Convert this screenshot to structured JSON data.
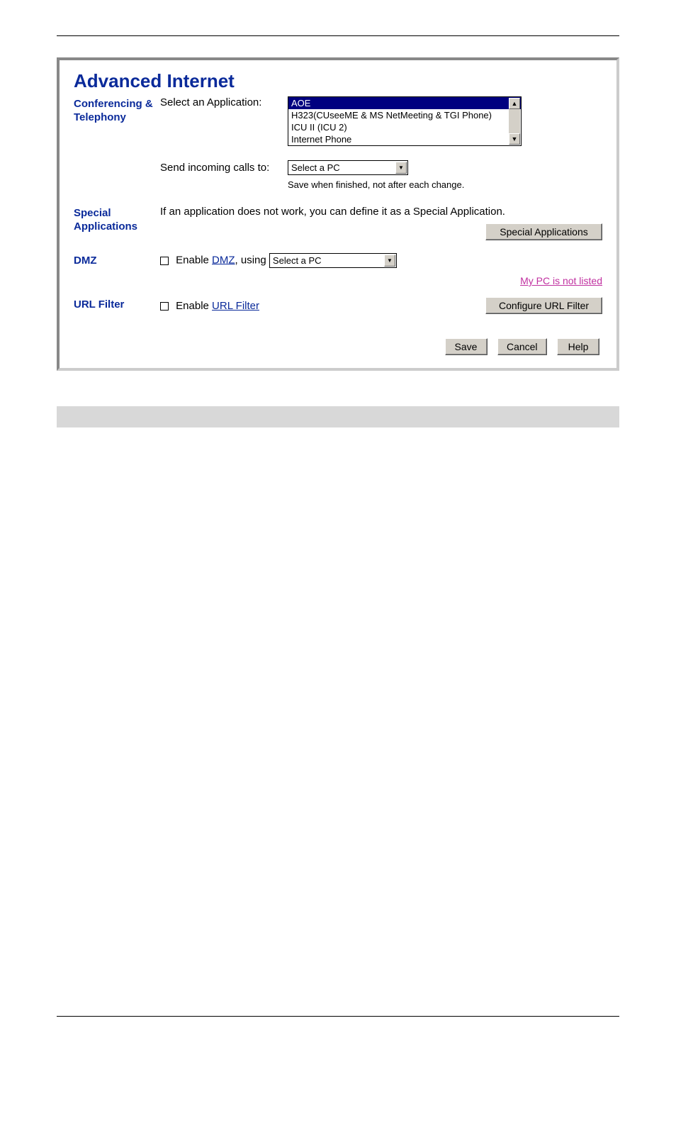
{
  "panel": {
    "title": "Advanced Internet",
    "sections": {
      "conferencing": {
        "label": "Conferencing & Telephony",
        "select_app_label": "Select an Application:",
        "app_options": [
          "AOE",
          "H323(CUseeME & MS NetMeeting & TGI Phone)",
          "ICU II (ICU 2)",
          "Internet Phone"
        ],
        "send_calls_label": "Send incoming calls to:",
        "pc_selected": "Select a PC",
        "save_note": "Save when finished, not after each change."
      },
      "special": {
        "label": "Special Applications",
        "desc": "If an application does not work, you can define it as a Special Application.",
        "button": "Special Applications"
      },
      "dmz": {
        "label": "DMZ",
        "enable_prefix": "Enable ",
        "link": "DMZ",
        "enable_suffix": ", using ",
        "pc_selected": "Select a PC",
        "not_listed_link": "My PC is not listed"
      },
      "urlfilter": {
        "label": "URL Filter",
        "enable_prefix": "Enable ",
        "link": "URL Filter",
        "button": "Configure URL Filter"
      }
    },
    "buttons": {
      "save": "Save",
      "cancel": "Cancel",
      "help": "Help"
    }
  }
}
